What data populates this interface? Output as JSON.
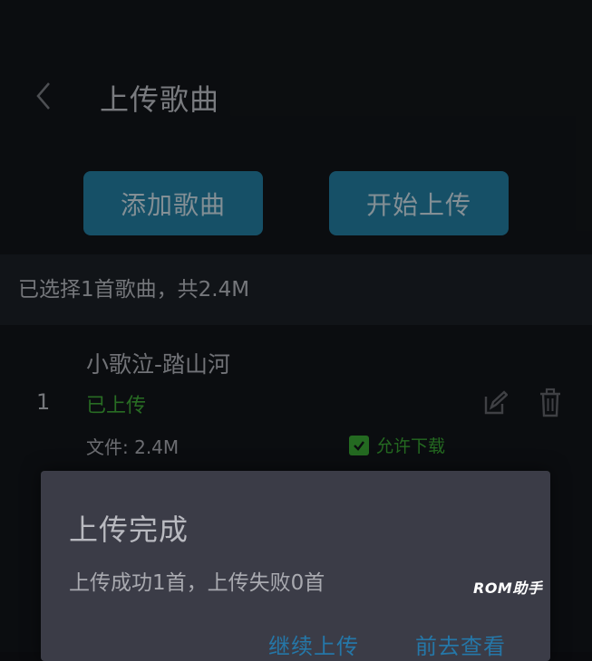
{
  "header": {
    "title": "上传歌曲",
    "back_icon": "chevron-left-icon"
  },
  "actions": {
    "add_label": "添加歌曲",
    "upload_label": "开始上传"
  },
  "summary": {
    "text": "已选择1首歌曲，共2.4M"
  },
  "songs": [
    {
      "index": "1",
      "title": "小歌泣-踏山河",
      "status": "已上传",
      "size": "文件: 2.4M",
      "allow_download_label": "允许下载",
      "allow_download_checked": true
    }
  ],
  "dialog": {
    "title": "上传完成",
    "message": "上传成功1首，上传失败0首",
    "continue_label": "继续上传",
    "view_label": "前去查看"
  },
  "watermark": "ROM助手",
  "colors": {
    "accent_button": "#1b5f7a",
    "status_green": "#2f7f2a",
    "dialog_link": "#2577a8",
    "dialog_bg": "#3b3c47"
  }
}
